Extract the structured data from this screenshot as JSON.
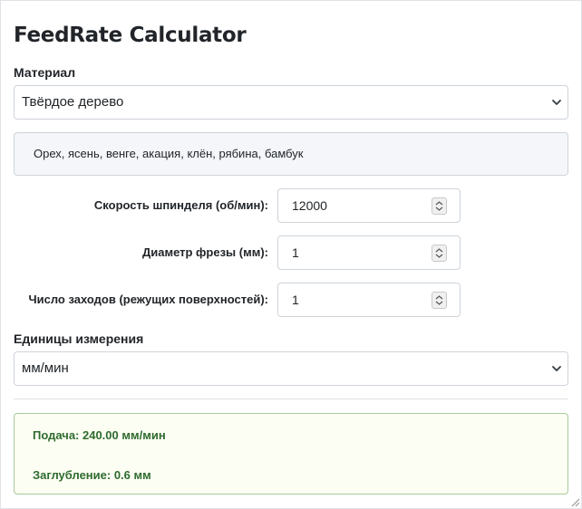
{
  "app": {
    "title": "FeedRate Calculator"
  },
  "material": {
    "label": "Материал",
    "selected": "Твёрдое дерево",
    "description": "Орех, ясень, венге, акация, клён, рябина, бамбук"
  },
  "inputs": [
    {
      "label": "Скорость шпинделя (об/мин):",
      "value": "12000"
    },
    {
      "label": "Диаметр фрезы (мм):",
      "value": "1"
    },
    {
      "label": "Число заходов (режущих поверхностей):",
      "value": "1"
    }
  ],
  "units": {
    "label": "Единицы измерения",
    "selected": "мм/мин"
  },
  "result": {
    "feed": "Подача: 240.00 мм/мин",
    "depth": "Заглубление: 0.6 мм"
  }
}
